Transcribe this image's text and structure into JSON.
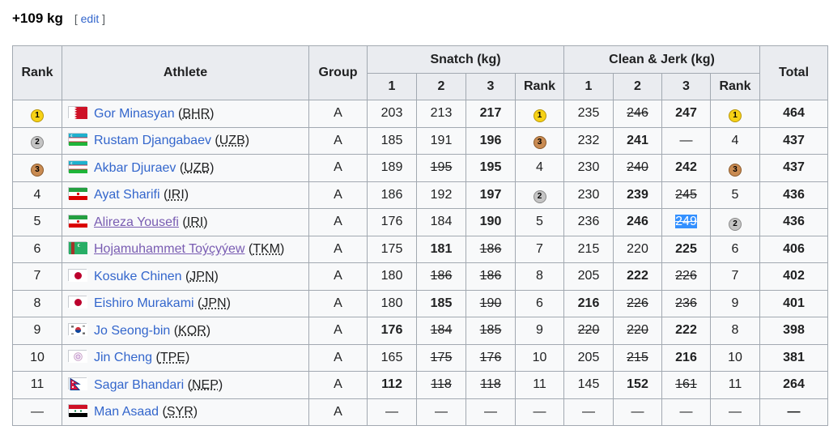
{
  "heading": {
    "title": "+109 kg",
    "edit_open": "[ ",
    "edit_label": "edit",
    "edit_close": " ]"
  },
  "table": {
    "headers": {
      "rank": "Rank",
      "athlete": "Athlete",
      "group": "Group",
      "snatch": "Snatch (kg)",
      "cj": "Clean & Jerk (kg)",
      "total": "Total",
      "a1": "1",
      "a2": "2",
      "a3": "3",
      "srank": "Rank",
      "b1": "1",
      "b2": "2",
      "b3": "3",
      "crank": "Rank"
    },
    "rows": [
      {
        "rank": {
          "t": "1",
          "m": "gold"
        },
        "name": "Gor Minasyan",
        "noc": "BHR",
        "flag": "bhr",
        "group": "A",
        "s1": {
          "t": "203"
        },
        "s2": {
          "t": "213"
        },
        "s3": {
          "t": "217",
          "b": true
        },
        "srank": {
          "t": "1",
          "m": "gold"
        },
        "c1": {
          "t": "235"
        },
        "c2": {
          "t": "246",
          "f": true
        },
        "c3": {
          "t": "247",
          "b": true
        },
        "crank": {
          "t": "1",
          "m": "gold"
        },
        "total": "464"
      },
      {
        "rank": {
          "t": "2",
          "m": "silver"
        },
        "name": "Rustam Djangabaev",
        "noc": "UZB",
        "flag": "uzb",
        "group": "A",
        "s1": {
          "t": "185"
        },
        "s2": {
          "t": "191"
        },
        "s3": {
          "t": "196",
          "b": true
        },
        "srank": {
          "t": "3",
          "m": "bronze"
        },
        "c1": {
          "t": "232"
        },
        "c2": {
          "t": "241",
          "b": true
        },
        "c3": {
          "t": "—"
        },
        "crank": {
          "t": "4"
        },
        "total": "437"
      },
      {
        "rank": {
          "t": "3",
          "m": "bronze"
        },
        "name": "Akbar Djuraev",
        "noc": "UZB",
        "flag": "uzb",
        "group": "A",
        "s1": {
          "t": "189"
        },
        "s2": {
          "t": "195",
          "f": true
        },
        "s3": {
          "t": "195",
          "b": true
        },
        "srank": {
          "t": "4"
        },
        "c1": {
          "t": "230"
        },
        "c2": {
          "t": "240",
          "f": true
        },
        "c3": {
          "t": "242",
          "b": true
        },
        "crank": {
          "t": "3",
          "m": "bronze"
        },
        "total": "437"
      },
      {
        "rank": {
          "t": "4"
        },
        "name": "Ayat Sharifi",
        "noc": "IRI",
        "flag": "iri",
        "group": "A",
        "s1": {
          "t": "186"
        },
        "s2": {
          "t": "192"
        },
        "s3": {
          "t": "197",
          "b": true
        },
        "srank": {
          "t": "2",
          "m": "silver"
        },
        "c1": {
          "t": "230"
        },
        "c2": {
          "t": "239",
          "b": true
        },
        "c3": {
          "t": "245",
          "f": true
        },
        "crank": {
          "t": "5"
        },
        "total": "436"
      },
      {
        "rank": {
          "t": "5"
        },
        "name": "Alireza Yousefi",
        "noc": "IRI",
        "flag": "iri",
        "group": "A",
        "visited": true,
        "s1": {
          "t": "176"
        },
        "s2": {
          "t": "184"
        },
        "s3": {
          "t": "190",
          "b": true
        },
        "srank": {
          "t": "5"
        },
        "c1": {
          "t": "236"
        },
        "c2": {
          "t": "246",
          "b": true
        },
        "c3": {
          "t": "249",
          "f": true,
          "sel": true
        },
        "crank": {
          "t": "2",
          "m": "silver"
        },
        "total": "436"
      },
      {
        "rank": {
          "t": "6"
        },
        "name": "Hojamuhammet Toýçyýew",
        "noc": "TKM",
        "flag": "tkm",
        "group": "A",
        "visited": true,
        "s1": {
          "t": "175"
        },
        "s2": {
          "t": "181",
          "b": true
        },
        "s3": {
          "t": "186",
          "f": true
        },
        "srank": {
          "t": "7"
        },
        "c1": {
          "t": "215"
        },
        "c2": {
          "t": "220"
        },
        "c3": {
          "t": "225",
          "b": true
        },
        "crank": {
          "t": "6"
        },
        "total": "406"
      },
      {
        "rank": {
          "t": "7"
        },
        "name": "Kosuke Chinen",
        "noc": "JPN",
        "flag": "jpn",
        "group": "A",
        "s1": {
          "t": "180"
        },
        "s2": {
          "t": "186",
          "f": true
        },
        "s3": {
          "t": "186",
          "f": true
        },
        "srank": {
          "t": "8"
        },
        "c1": {
          "t": "205"
        },
        "c2": {
          "t": "222",
          "b": true
        },
        "c3": {
          "t": "226",
          "f": true
        },
        "crank": {
          "t": "7"
        },
        "total": "402"
      },
      {
        "rank": {
          "t": "8"
        },
        "name": "Eishiro Murakami",
        "noc": "JPN",
        "flag": "jpn",
        "group": "A",
        "s1": {
          "t": "180"
        },
        "s2": {
          "t": "185",
          "b": true
        },
        "s3": {
          "t": "190",
          "f": true
        },
        "srank": {
          "t": "6"
        },
        "c1": {
          "t": "216",
          "b": true
        },
        "c2": {
          "t": "226",
          "f": true
        },
        "c3": {
          "t": "236",
          "f": true
        },
        "crank": {
          "t": "9"
        },
        "total": "401"
      },
      {
        "rank": {
          "t": "9"
        },
        "name": "Jo Seong-bin",
        "noc": "KOR",
        "flag": "kor",
        "group": "A",
        "s1": {
          "t": "176",
          "b": true
        },
        "s2": {
          "t": "184",
          "f": true
        },
        "s3": {
          "t": "185",
          "f": true
        },
        "srank": {
          "t": "9"
        },
        "c1": {
          "t": "220",
          "f": true
        },
        "c2": {
          "t": "220",
          "f": true
        },
        "c3": {
          "t": "222",
          "b": true
        },
        "crank": {
          "t": "8"
        },
        "total": "398"
      },
      {
        "rank": {
          "t": "10"
        },
        "name": "Jin Cheng",
        "noc": "TPE",
        "flag": "tpe",
        "group": "A",
        "s1": {
          "t": "165"
        },
        "s2": {
          "t": "175",
          "f": true
        },
        "s3": {
          "t": "176",
          "f": true
        },
        "srank": {
          "t": "10"
        },
        "c1": {
          "t": "205"
        },
        "c2": {
          "t": "215",
          "f": true
        },
        "c3": {
          "t": "216",
          "b": true
        },
        "crank": {
          "t": "10"
        },
        "total": "381"
      },
      {
        "rank": {
          "t": "11"
        },
        "name": "Sagar Bhandari",
        "noc": "NEP",
        "flag": "nep",
        "group": "A",
        "s1": {
          "t": "112",
          "b": true
        },
        "s2": {
          "t": "118",
          "f": true
        },
        "s3": {
          "t": "118",
          "f": true
        },
        "srank": {
          "t": "11"
        },
        "c1": {
          "t": "145"
        },
        "c2": {
          "t": "152",
          "b": true
        },
        "c3": {
          "t": "161",
          "f": true
        },
        "crank": {
          "t": "11"
        },
        "total": "264"
      },
      {
        "rank": {
          "t": "—"
        },
        "name": "Man Asaad",
        "noc": "SYR",
        "flag": "syr",
        "group": "A",
        "s1": {
          "t": "—"
        },
        "s2": {
          "t": "—"
        },
        "s3": {
          "t": "—"
        },
        "srank": {
          "t": "—"
        },
        "c1": {
          "t": "—"
        },
        "c2": {
          "t": "—"
        },
        "c3": {
          "t": "—"
        },
        "crank": {
          "t": "—"
        },
        "total": "—"
      }
    ]
  }
}
